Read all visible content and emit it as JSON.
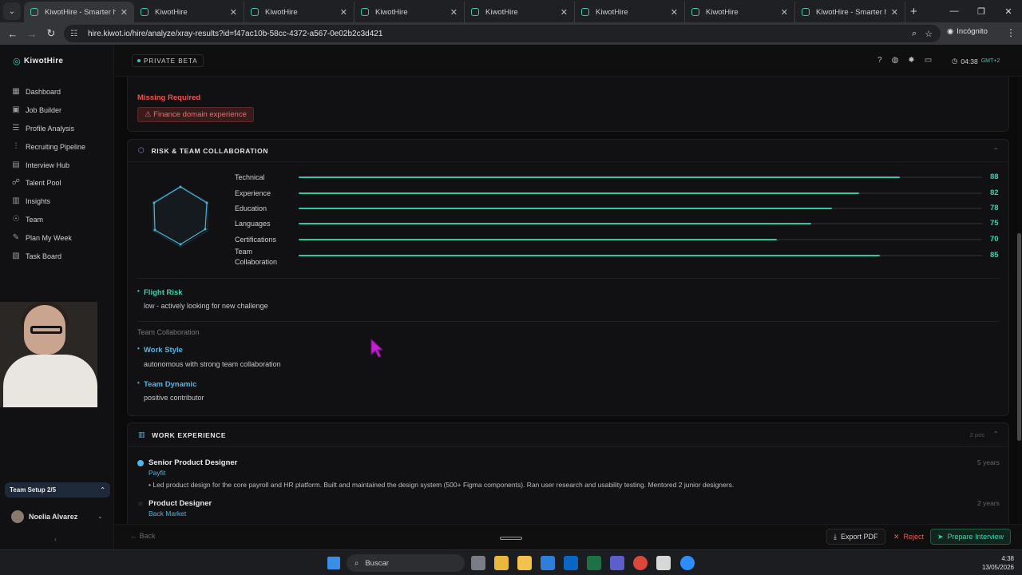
{
  "browser": {
    "tabs": [
      {
        "title": "KiwotHire - Smarter hiring",
        "active": true
      },
      {
        "title": "KiwotHire",
        "active": false
      },
      {
        "title": "KiwotHire",
        "active": false
      },
      {
        "title": "KiwotHire",
        "active": false
      },
      {
        "title": "KiwotHire",
        "active": false
      },
      {
        "title": "KiwotHire",
        "active": false
      },
      {
        "title": "KiwotHire",
        "active": false
      },
      {
        "title": "KiwotHire - Smarter hiring",
        "active": false
      }
    ],
    "url": "hire.kiwot.io/hire/analyze/xray-results?id=f47ac10b-58cc-4372-a567-0e02b2c3d421",
    "incognito_label": "Incógnito"
  },
  "app": {
    "logo": "KiwotHire",
    "beta_label": "PRIVATE BETA",
    "clock": "04:38",
    "timezone": "GMT+2",
    "accent": "#3bd2ad"
  },
  "sidebar": {
    "items": [
      {
        "label": "Dashboard",
        "icon": "grid-icon"
      },
      {
        "label": "Job Builder",
        "icon": "briefcase-icon"
      },
      {
        "label": "Profile Analysis",
        "icon": "list-icon"
      },
      {
        "label": "Recruiting Pipeline",
        "icon": "pipeline-icon"
      },
      {
        "label": "Interview Hub",
        "icon": "calendar-icon"
      },
      {
        "label": "Talent Pool",
        "icon": "users-icon"
      },
      {
        "label": "Insights",
        "icon": "chart-icon"
      },
      {
        "label": "Team",
        "icon": "team-icon"
      },
      {
        "label": "Plan My Week",
        "icon": "plan-icon"
      },
      {
        "label": "Task Board",
        "icon": "board-icon"
      }
    ],
    "setup_label": "Team Setup 2/5",
    "user_name": "Noelia Alvarez"
  },
  "missing": {
    "label": "Missing Required",
    "tag": "⚠ Finance domain experience"
  },
  "risk_card": {
    "title": "RISK & TEAM COLLABORATION",
    "scores": [
      {
        "label": "Technical",
        "value": 88,
        "display": "88"
      },
      {
        "label": "Experience",
        "value": 82,
        "display": "82"
      },
      {
        "label": "Education",
        "value": 78,
        "display": "78"
      },
      {
        "label": "Languages",
        "value": 75,
        "display": "75"
      },
      {
        "label": "Certifications",
        "value": 70,
        "display": "70"
      },
      {
        "label": "Team Collaboration",
        "value": 85,
        "display": "85"
      }
    ],
    "flight_risk_title": "Flight Risk",
    "flight_risk_text": "low - actively looking for new challenge",
    "collab_heading": "Team Collaboration",
    "work_style_title": "Work Style",
    "work_style_text": "autonomous with strong team collaboration",
    "team_dynamic_title": "Team Dynamic",
    "team_dynamic_text": "positive contributor"
  },
  "work_card": {
    "title": "WORK EXPERIENCE",
    "meta": "2 pos",
    "positions": [
      {
        "title": "Senior Product Designer",
        "company": "Payfit",
        "years": "5 years",
        "desc": "Led product design for the core payroll and HR platform. Built and maintained the design system (500+ Figma components). Ran user research and usability testing. Mentored 2 junior designers."
      },
      {
        "title": "Product Designer",
        "company": "Back Market",
        "years": "2 years"
      }
    ]
  },
  "footer": {
    "back": "Back",
    "export": "Export PDF",
    "reject": "Reject",
    "prepare": "Prepare Interview"
  },
  "taskbar": {
    "search_placeholder": "Buscar",
    "time": "4:38",
    "date": "13/05/2026"
  }
}
